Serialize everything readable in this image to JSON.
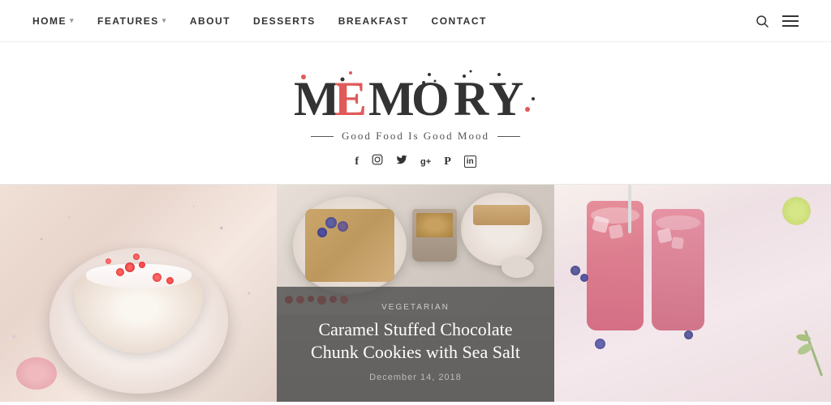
{
  "nav": {
    "items": [
      {
        "label": "HOME",
        "hasDropdown": true
      },
      {
        "label": "FEATURES",
        "hasDropdown": true
      },
      {
        "label": "ABOUT",
        "hasDropdown": false
      },
      {
        "label": "DESSERTS",
        "hasDropdown": false
      },
      {
        "label": "BREAKFAST",
        "hasDropdown": false
      },
      {
        "label": "CONTACT",
        "hasDropdown": false
      }
    ],
    "search_label": "search",
    "menu_label": "menu"
  },
  "hero": {
    "logo": "MEMORY",
    "tagline": "Good Food Is Good Mood",
    "social": [
      {
        "name": "facebook",
        "icon": "f"
      },
      {
        "name": "instagram",
        "icon": "◎"
      },
      {
        "name": "twitter",
        "icon": "t"
      },
      {
        "name": "google-plus",
        "icon": "g+"
      },
      {
        "name": "pinterest",
        "icon": "p"
      },
      {
        "name": "linkedin",
        "icon": "in"
      }
    ]
  },
  "grid": {
    "items": [
      {
        "type": "image",
        "alt": "Cake with red berries"
      },
      {
        "type": "featured",
        "category": "VEGETARIAN",
        "title": "Caramel Stuffed Chocolate Chunk Cookies with Sea Salt",
        "date": "December 14, 2018",
        "alt": "Food plate with blueberries"
      },
      {
        "type": "image",
        "alt": "Pink drinks with berries"
      }
    ]
  }
}
